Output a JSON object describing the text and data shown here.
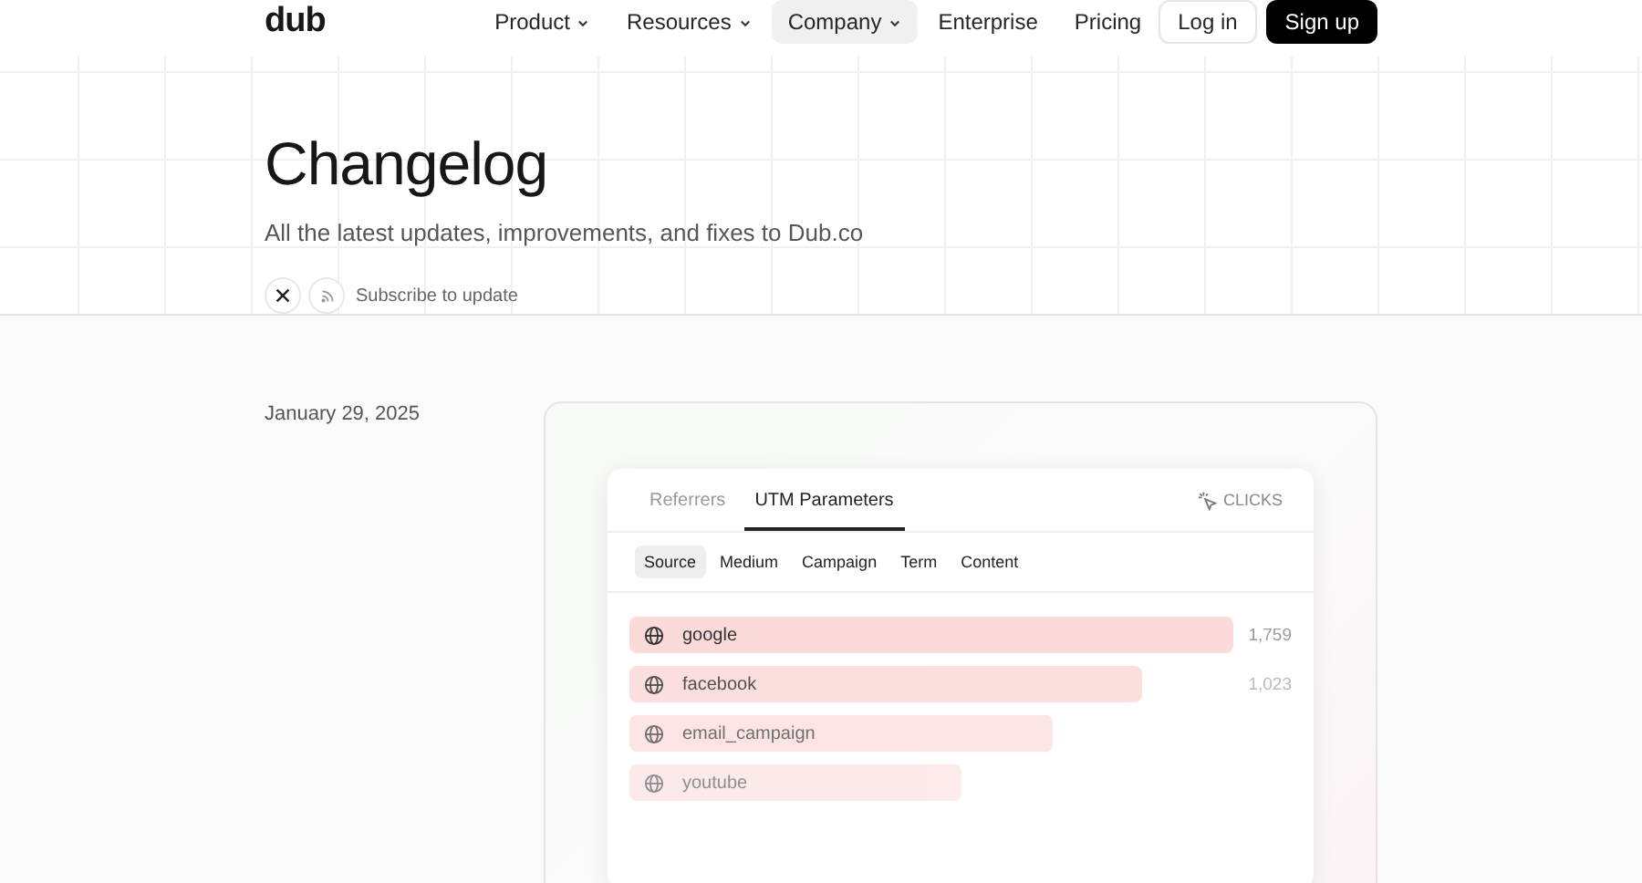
{
  "header": {
    "logo": "dub",
    "nav": [
      {
        "label": "Product",
        "dropdown": true,
        "selected": false
      },
      {
        "label": "Resources",
        "dropdown": true,
        "selected": false
      },
      {
        "label": "Company",
        "dropdown": true,
        "selected": true
      },
      {
        "label": "Enterprise",
        "dropdown": false,
        "selected": false
      },
      {
        "label": "Pricing",
        "dropdown": false,
        "selected": false
      }
    ],
    "login": "Log in",
    "signup": "Sign up"
  },
  "hero": {
    "title": "Changelog",
    "subtitle": "All the latest updates, improvements, and fixes to Dub.co",
    "subscribe": "Subscribe to update"
  },
  "entry": {
    "date": "January 29, 2025",
    "panel": {
      "tabs": [
        {
          "label": "Referrers",
          "selected": false
        },
        {
          "label": "UTM Parameters",
          "selected": true
        }
      ],
      "metric": "CLICKS",
      "subtabs": [
        {
          "label": "Source",
          "selected": true
        },
        {
          "label": "Medium",
          "selected": false
        },
        {
          "label": "Campaign",
          "selected": false
        },
        {
          "label": "Term",
          "selected": false
        },
        {
          "label": "Content",
          "selected": false
        }
      ],
      "rows": [
        {
          "name": "google",
          "value": "1,759"
        },
        {
          "name": "facebook",
          "value": "1,023"
        },
        {
          "name": "email_campaign"
        },
        {
          "name": "youtube"
        }
      ]
    }
  }
}
